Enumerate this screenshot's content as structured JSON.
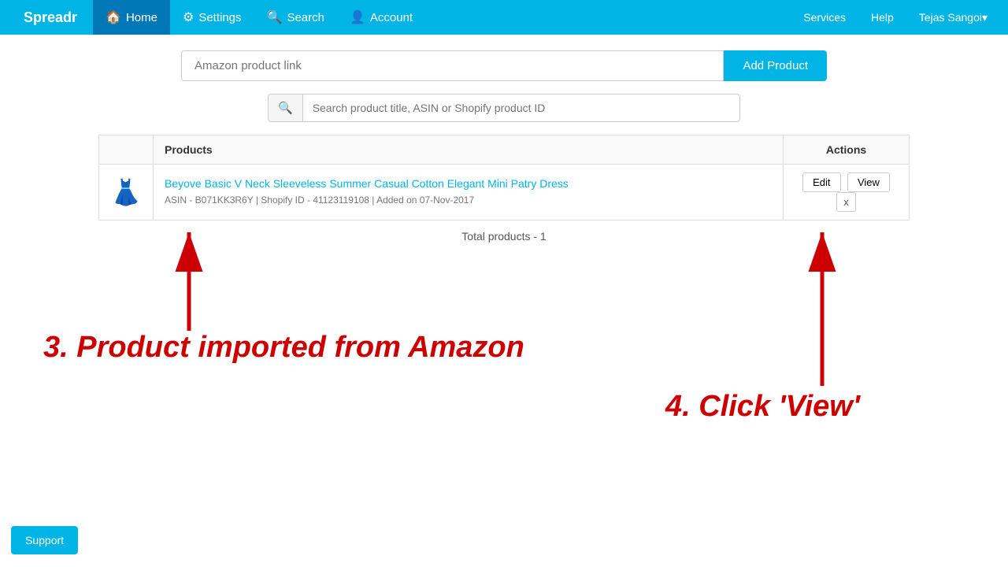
{
  "navbar": {
    "brand": "Spreadr",
    "items": [
      {
        "label": "Home",
        "icon": "🏠",
        "active": true
      },
      {
        "label": "Settings",
        "icon": "⚙"
      },
      {
        "label": "Search",
        "icon": "🔍"
      },
      {
        "label": "Account",
        "icon": "👤"
      }
    ],
    "right_items": [
      {
        "label": "Services"
      },
      {
        "label": "Help"
      },
      {
        "label": "Tejas Sangoi▾"
      }
    ]
  },
  "product_link_input": {
    "placeholder": "Amazon product link",
    "add_button_label": "Add Product"
  },
  "product_search": {
    "placeholder": "Search product title, ASIN or Shopify product ID"
  },
  "table": {
    "headers": [
      "",
      "Products",
      "Actions"
    ],
    "rows": [
      {
        "title": "Beyove Basic V Neck Sleeveless Summer Casual Cotton Elegant Mini Patry Dress",
        "meta": "ASIN - B071KK3R6Y  |  Shopify ID - 41123119108  |  Added on 07-Nov-2017",
        "actions": [
          "Edit",
          "View",
          "x"
        ]
      }
    ],
    "total_label": "Total products - 1"
  },
  "annotations": {
    "step3": "3. Product imported from Amazon",
    "step4": "4. Click 'View'"
  },
  "support_button": "Support"
}
